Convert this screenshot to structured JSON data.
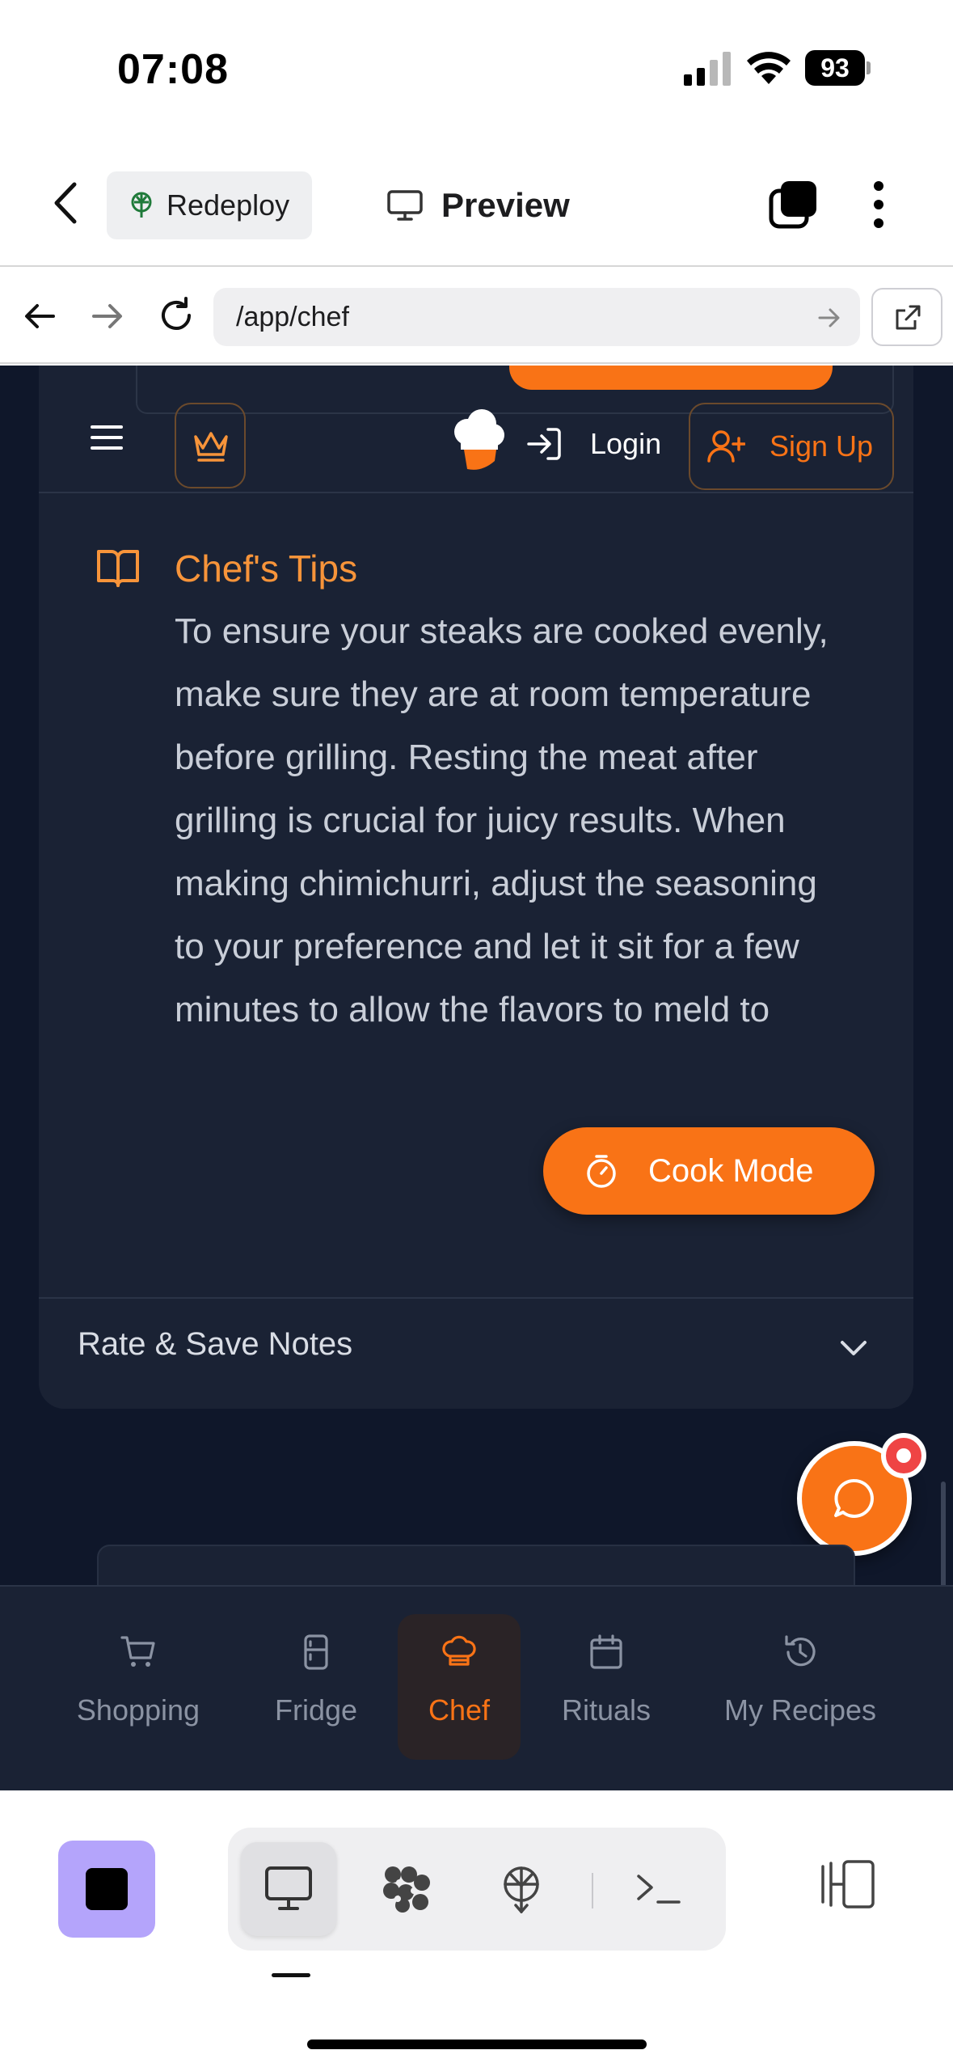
{
  "status_bar": {
    "time": "07:08",
    "battery": "93"
  },
  "host_toolbar": {
    "redeploy_label": "Redeploy",
    "preview_label": "Preview"
  },
  "browser": {
    "url": "/app/chef"
  },
  "app_header": {
    "login_label": "Login",
    "signup_label": "Sign Up"
  },
  "tips": {
    "title": "Chef's Tips",
    "body": "To ensure your steaks are cooked evenly, make sure they are at room temperature before grilling. Resting the meat after grilling is crucial for juicy results. When making chimichurri, adjust the seasoning to your preference and let it sit for a few minutes to allow the flavors to meld to"
  },
  "rate_section": {
    "label": "Rate & Save Notes"
  },
  "cook_mode": {
    "label": "Cook Mode"
  },
  "bottom_nav": {
    "items": [
      {
        "label": "Shopping",
        "icon": "cart-icon"
      },
      {
        "label": "Fridge",
        "icon": "fridge-icon"
      },
      {
        "label": "Chef",
        "icon": "chef-hat-icon",
        "active": true
      },
      {
        "label": "Rituals",
        "icon": "calendar-icon"
      },
      {
        "label": "My Recipes",
        "icon": "history-icon"
      }
    ]
  },
  "colors": {
    "accent": "#f97316",
    "app_background": "#0f172a",
    "card_background": "#1a2234",
    "stop_button": "#b4a4fb"
  }
}
